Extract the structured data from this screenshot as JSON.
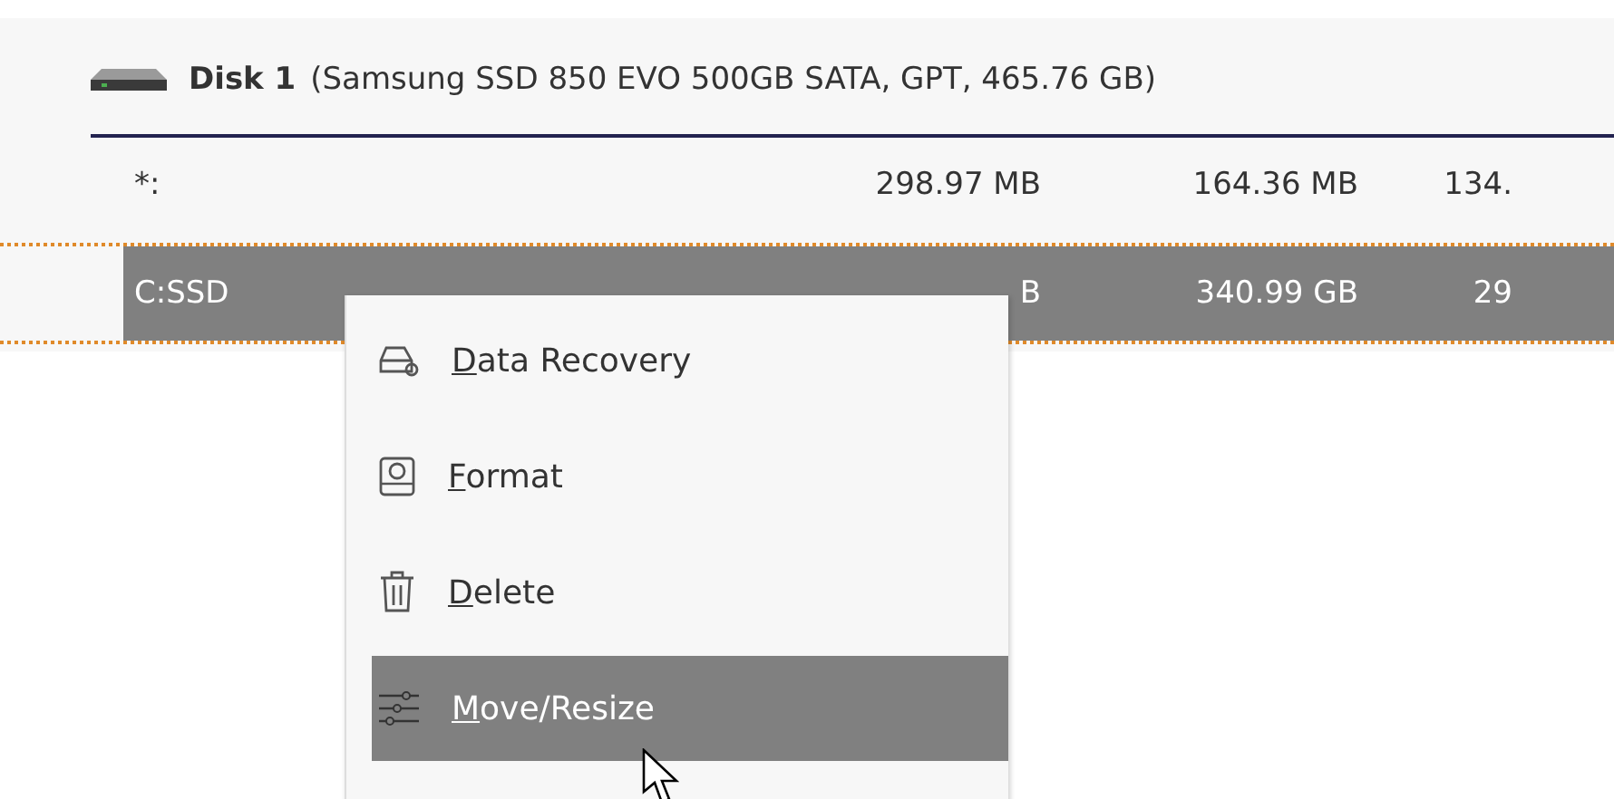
{
  "disk": {
    "name": "Disk 1",
    "details": "(Samsung SSD 850 EVO 500GB SATA, GPT, 465.76 GB)"
  },
  "partitions": [
    {
      "name": "*:",
      "column_2": "298.97 MB",
      "column_3": "164.36 MB",
      "column_4": "134.",
      "selected": false
    },
    {
      "name": "C:SSD",
      "column_2": "B",
      "column_3": "340.99 GB",
      "column_4": "29",
      "selected": true
    }
  ],
  "context_menu": [
    {
      "kind": "recovery",
      "label": "Data Recovery",
      "selected": false
    },
    {
      "kind": "format",
      "label": "Format",
      "selected": false
    },
    {
      "kind": "delete",
      "label": "Delete",
      "selected": false
    },
    {
      "kind": "resize",
      "label": "Move/Resize",
      "selected": true
    }
  ]
}
